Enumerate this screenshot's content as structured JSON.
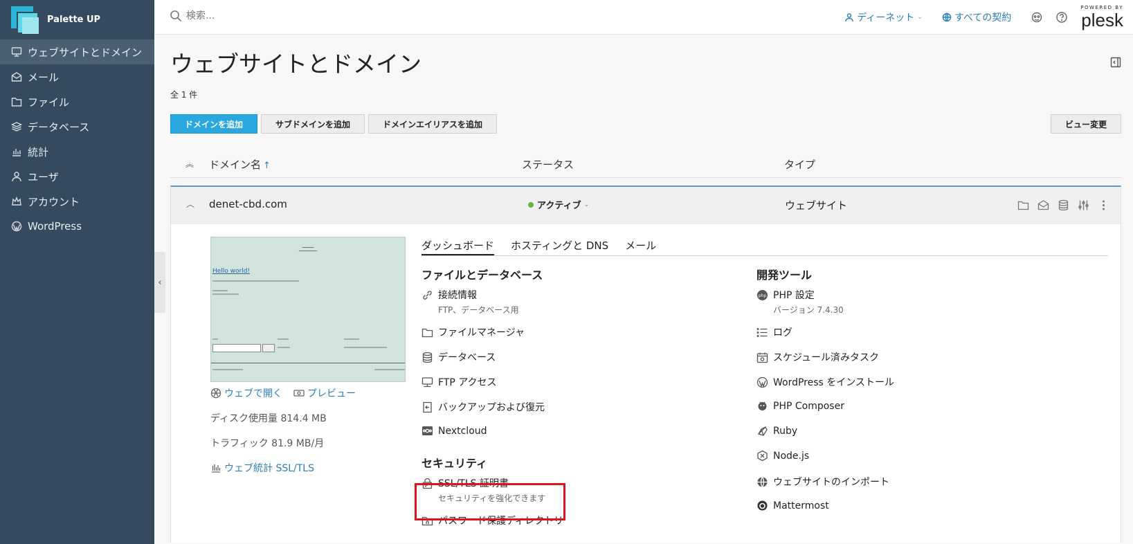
{
  "sidebar": {
    "brand": "Palette UP",
    "items": [
      {
        "label": "ウェブサイトとドメイン",
        "icon": "monitor-icon"
      },
      {
        "label": "メール",
        "icon": "mail-icon"
      },
      {
        "label": "ファイル",
        "icon": "folder-icon"
      },
      {
        "label": "データベース",
        "icon": "database-layers-icon"
      },
      {
        "label": "統計",
        "icon": "bar-chart-icon"
      },
      {
        "label": "ユーザ",
        "icon": "user-icon"
      },
      {
        "label": "アカウント",
        "icon": "crown-icon"
      },
      {
        "label": "WordPress",
        "icon": "wordpress-icon"
      }
    ]
  },
  "topbar": {
    "search_placeholder": "検索...",
    "user": "ディーネット",
    "subscriptions": "すべての契約",
    "powered_by": "POWERED BY",
    "plesk": "plesk"
  },
  "main": {
    "title": "ウェブサイトとドメイン",
    "count": "全 1 件",
    "buttons": {
      "add_domain": "ドメインを追加",
      "add_subdomain": "サブドメインを追加",
      "add_alias": "ドメインエイリアスを追加",
      "change_view": "ビュー変更"
    },
    "columns": {
      "name": "ドメイン名",
      "status": "ステータス",
      "type": "タイプ"
    },
    "domain": {
      "name": "denet-cbd.com",
      "status": "アクティブ",
      "type": "ウェブサイト",
      "status_color": "#6cb23c"
    },
    "preview": {
      "hello": "Hello world!"
    },
    "left_links": {
      "open_web": "ウェブで開く",
      "preview": "プレビュー",
      "disk": "ディスク使用量 814.4 MB",
      "traffic": "トラフィック 81.9 MB/月",
      "stats": "ウェブ統計 SSL/TLS"
    },
    "tabs": [
      "ダッシュボード",
      "ホスティングと DNS",
      "メール"
    ],
    "files_section": {
      "title": "ファイルとデータベース",
      "items": [
        {
          "label": "接続情報",
          "sub": "FTP、データベース用"
        },
        {
          "label": "ファイルマネージャ"
        },
        {
          "label": "データベース"
        },
        {
          "label": "FTP アクセス"
        },
        {
          "label": "バックアップおよび復元"
        },
        {
          "label": "Nextcloud"
        }
      ]
    },
    "security_section": {
      "title": "セキュリティ",
      "items": [
        {
          "label": "SSL/TLS 証明書",
          "sub": "セキュリティを強化できます"
        },
        {
          "label": "パスワード保護ディレクトリ"
        }
      ]
    },
    "dev_section": {
      "title": "開発ツール",
      "items": [
        {
          "label": "PHP 設定",
          "sub": "バージョン 7.4.30"
        },
        {
          "label": "ログ"
        },
        {
          "label": "スケジュール済みタスク"
        },
        {
          "label": "WordPress をインストール"
        },
        {
          "label": "PHP Composer"
        },
        {
          "label": "Ruby"
        },
        {
          "label": "Node.js"
        },
        {
          "label": "ウェブサイトのインポート"
        },
        {
          "label": "Mattermost"
        }
      ]
    },
    "accent_color": "#28a8de",
    "highlight_color": "#e0121c"
  }
}
